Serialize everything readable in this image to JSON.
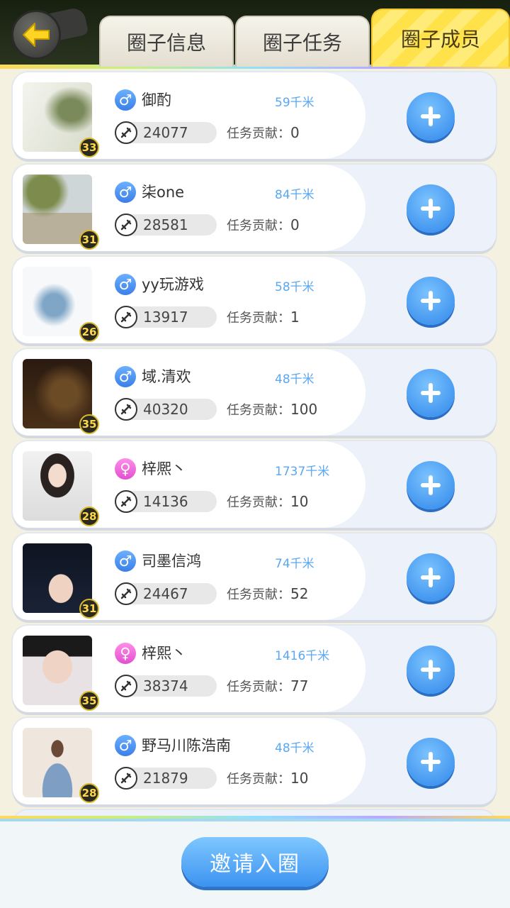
{
  "tabs": [
    {
      "label": "圈子信息"
    },
    {
      "label": "圈子任务"
    },
    {
      "label": "圈子成员"
    }
  ],
  "contribution_label": "任务贡献：",
  "members": [
    {
      "name": "御酌",
      "gender": "male",
      "distance": "59千米",
      "score": "24077",
      "contribution": "0",
      "level": "33"
    },
    {
      "name": "柒one",
      "gender": "male",
      "distance": "84千米",
      "score": "28581",
      "contribution": "0",
      "level": "31"
    },
    {
      "name": "yy玩游戏",
      "gender": "male",
      "distance": "58千米",
      "score": "13917",
      "contribution": "1",
      "level": "26"
    },
    {
      "name": "域.清欢",
      "gender": "male",
      "distance": "48千米",
      "score": "40320",
      "contribution": "100",
      "level": "35"
    },
    {
      "name": "梓熈丶",
      "gender": "female",
      "distance": "1737千米",
      "score": "14136",
      "contribution": "10",
      "level": "28"
    },
    {
      "name": "司墨信鸿",
      "gender": "male",
      "distance": "74千米",
      "score": "24467",
      "contribution": "52",
      "level": "31"
    },
    {
      "name": "梓熙丶",
      "gender": "female",
      "distance": "1416千米",
      "score": "38374",
      "contribution": "77",
      "level": "35"
    },
    {
      "name": "野马川陈浩南",
      "gender": "male",
      "distance": "48千米",
      "score": "21879",
      "contribution": "10",
      "level": "28"
    }
  ],
  "invite_label": "邀请入圈",
  "colors": {
    "accent": "#3c93f0",
    "tab_active": "#ffe14a",
    "male": "#3b7fe8",
    "female": "#e24fd0"
  }
}
